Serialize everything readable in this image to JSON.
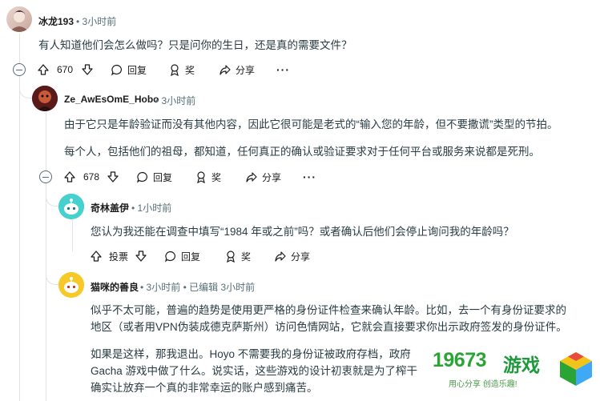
{
  "comments": [
    {
      "user": "冰龙193",
      "time": "3小时前",
      "body": [
        "有人知道他们会怎么做吗？只是问你的生日，还是真的需要文件？"
      ],
      "votes": "670",
      "reply_label": "回复",
      "award_label": "奖",
      "share_label": "分享",
      "more_label": "···"
    },
    {
      "user": "Ze_AwEsOmE_Hobo",
      "time": "3小时前",
      "body": [
        "由于它只是年龄验证而没有其他内容，因此它很可能是老式的“输入您的年龄，但不要撒谎”类型的节拍。",
        "每个人，包括他们的祖母，都知道，任何真正的确认或验证要求对于任何平台或服务来说都是死刑。"
      ],
      "votes": "678",
      "reply_label": "回复",
      "award_label": "奖",
      "share_label": "分享",
      "more_label": "···"
    },
    {
      "user": "奇林盖伊",
      "time": "1小时前",
      "body": [
        "您认为我还能在调查中填写“1984 年或之前”吗？或者确认后他们会停止询问我的年龄吗？"
      ],
      "votes": "投票",
      "reply_label": "回复",
      "award_label": "奖",
      "share_label": "分享"
    },
    {
      "user": "猫咪的善良",
      "time": "3小时前",
      "edited": "已编辑 3小时前",
      "body": [
        "似乎不太可能，普遍的趋势是使用更严格的身份证件检查来确认年龄。比如，去一个有身份证要求的",
        "地区（或者用VPN伪装成德克萨斯州）访问色情网站，它就会直接要求你出示政府签发的身份证件。",
        "如果是这样，那我退出。Hoyo 不需要我的身份证被政府存档，政府",
        "Gacha 游戏中做了什么。说实话，这些游戏的设计初衷就是为了榨干",
        "确实让放弃一个真的非常幸运的账户感到痛苦。"
      ]
    }
  ],
  "watermark": {
    "number": "19673",
    "text": "游戏",
    "slogan": "用心分享 创造乐趣!"
  },
  "colors": {
    "thread_line": "#e1e3e4",
    "meta_text": "#576f76",
    "body_text": "#2a3c42",
    "watermark_green": "#2aa535"
  }
}
